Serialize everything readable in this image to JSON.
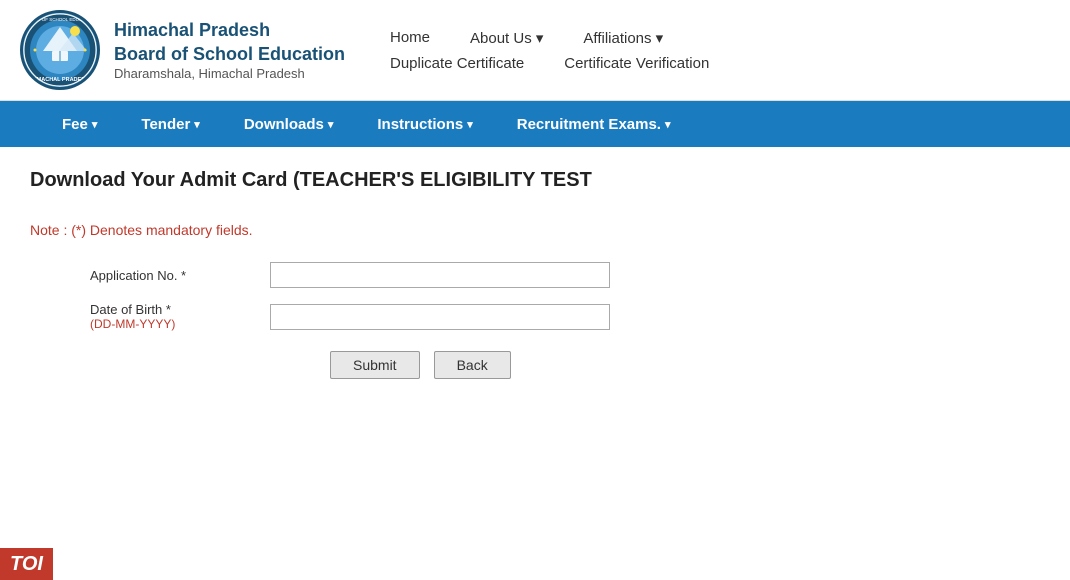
{
  "header": {
    "org_line1": "Himachal Pradesh",
    "org_line2": "Board of School Education",
    "org_line3": "Dharamshala, Himachal Pradesh",
    "nav_row1": [
      {
        "label": "Home",
        "has_arrow": false
      },
      {
        "label": "About Us",
        "has_arrow": true
      },
      {
        "label": "Affiliations",
        "has_arrow": true
      }
    ],
    "nav_row2": [
      {
        "label": "Duplicate Certificate",
        "has_arrow": false
      },
      {
        "label": "Certificate Verification",
        "has_arrow": false
      }
    ]
  },
  "blue_nav": {
    "items": [
      {
        "label": "Fee",
        "has_arrow": true
      },
      {
        "label": "Tender",
        "has_arrow": true
      },
      {
        "label": "Downloads",
        "has_arrow": true
      },
      {
        "label": "Instructions",
        "has_arrow": true
      },
      {
        "label": "Recruitment Exams.",
        "has_arrow": true
      }
    ]
  },
  "page": {
    "heading": "Download Your Admit Card (TEACHER'S ELIGIBILITY TEST",
    "note": "Note  : (*) Denotes mandatory fields.",
    "form": {
      "field1_label": "Application No. *",
      "field1_placeholder": "",
      "field2_label": "Date of Birth *",
      "field2_sublabel": "(DD-MM-YYYY)",
      "field2_placeholder": "",
      "submit_btn": "Submit",
      "back_btn": "Back"
    }
  },
  "toi": {
    "label": "TOI"
  }
}
